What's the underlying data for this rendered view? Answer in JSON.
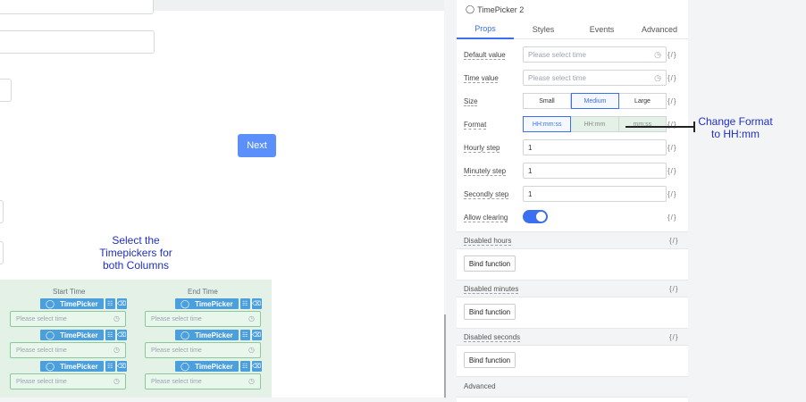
{
  "annotations": {
    "select_timepickers": "Select the Timepickers for both Columns",
    "change_format": "Change Format to HH:mm"
  },
  "canvas": {
    "next_button": "Next",
    "table": {
      "columns": [
        "Start Time",
        "End Time"
      ],
      "chip_label": "TimePicker",
      "placeholder": "Please select time",
      "rows": 3
    }
  },
  "panel": {
    "title": "TimePicker 2",
    "tabs": [
      "Props",
      "Styles",
      "Events",
      "Advanced"
    ],
    "active_tab": "Props",
    "fx_label": "{/}",
    "props": {
      "default_value": {
        "label": "Default value",
        "placeholder": "Please select time"
      },
      "time_value": {
        "label": "Time value",
        "placeholder": "Please select time"
      },
      "size": {
        "label": "Size",
        "options": [
          "Small",
          "Medium",
          "Large"
        ],
        "selected": "Medium"
      },
      "format": {
        "label": "Format",
        "options": [
          "HH:mm:ss",
          "HH:mm",
          "mm:ss"
        ],
        "selected": "HH:mm:ss"
      },
      "hourly_step": {
        "label": "Hourly step",
        "value": "1"
      },
      "minutely_step": {
        "label": "Minutely step",
        "value": "1"
      },
      "secondly_step": {
        "label": "Secondly step",
        "value": "1"
      },
      "allow_clearing": {
        "label": "Allow clearing",
        "on": true
      }
    },
    "sections": [
      {
        "label": "Disabled hours",
        "button": "Bind function"
      },
      {
        "label": "Disabled minutes",
        "button": "Bind function"
      },
      {
        "label": "Disabled seconds",
        "button": "Bind function"
      }
    ],
    "advanced_section": "Advanced"
  },
  "colors": {
    "accent": "#3b6ef0",
    "annotation": "#2030c0",
    "table_bg": "#e3f1e6",
    "chip": "#4a9fdc"
  }
}
